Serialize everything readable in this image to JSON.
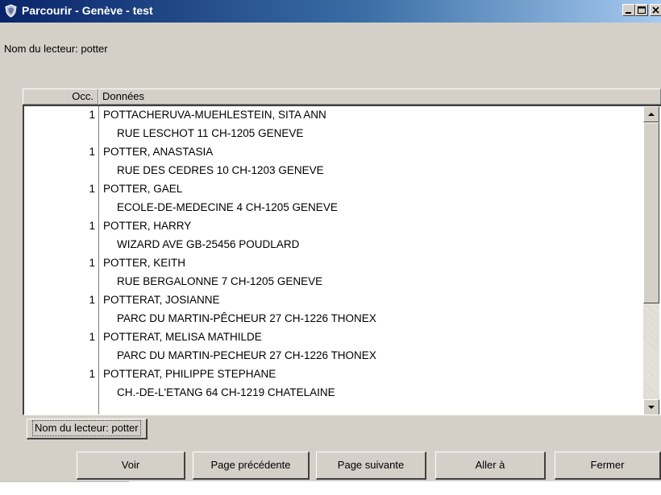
{
  "window": {
    "title": "Parcourir - Genève - test",
    "title_bar_gradient": [
      "#0a246a",
      "#a6caf0"
    ],
    "face_color": "#d4d0c8"
  },
  "header_label": "Nom du lecteur: potter",
  "table": {
    "columns": {
      "occ": "Occ.",
      "data": "Données"
    },
    "rows": [
      {
        "occ": "1",
        "name": "POTTACHERUVA-MUEHLESTEIN, SITA ANN",
        "address": "RUE LESCHOT 11 CH-1205 GENEVE"
      },
      {
        "occ": "1",
        "name": "POTTER, ANASTASIA",
        "address": "RUE DES CEDRES 10 CH-1203 GENEVE"
      },
      {
        "occ": "1",
        "name": "POTTER, GAEL",
        "address": "ECOLE-DE-MEDECINE 4 CH-1205 GENEVE"
      },
      {
        "occ": "1",
        "name": "POTTER, HARRY",
        "address": "WIZARD AVE GB-25456 POUDLARD"
      },
      {
        "occ": "1",
        "name": "POTTER, KEITH",
        "address": "RUE BERGALONNE 7 CH-1205 GENEVE"
      },
      {
        "occ": "1",
        "name": "POTTERAT, JOSIANNE",
        "address": "PARC DU MARTIN-PÊCHEUR 27 CH-1226 THONEX"
      },
      {
        "occ": "1",
        "name": "POTTERAT, MELISA MATHILDE",
        "address": "PARC DU MARTIN-PECHEUR  27 CH-1226 THONEX"
      },
      {
        "occ": "1",
        "name": "POTTERAT, PHILIPPE STEPHANE",
        "address": "CH.-DE-L'ETANG 64 CH-1219 CHATELAINE"
      }
    ]
  },
  "status_tab": "Nom du lecteur: potter",
  "buttons": {
    "view": "Voir",
    "previous_page": "Page précédente",
    "next_page": "Page suivante",
    "go_to": "Aller à",
    "close": "Fermer"
  },
  "icons": {
    "app": "shield-icon",
    "minimize": "minimize-icon",
    "maximize": "maximize-icon",
    "close": "close-icon",
    "scroll_up": "arrow-up-icon",
    "scroll_down": "arrow-down-icon"
  }
}
